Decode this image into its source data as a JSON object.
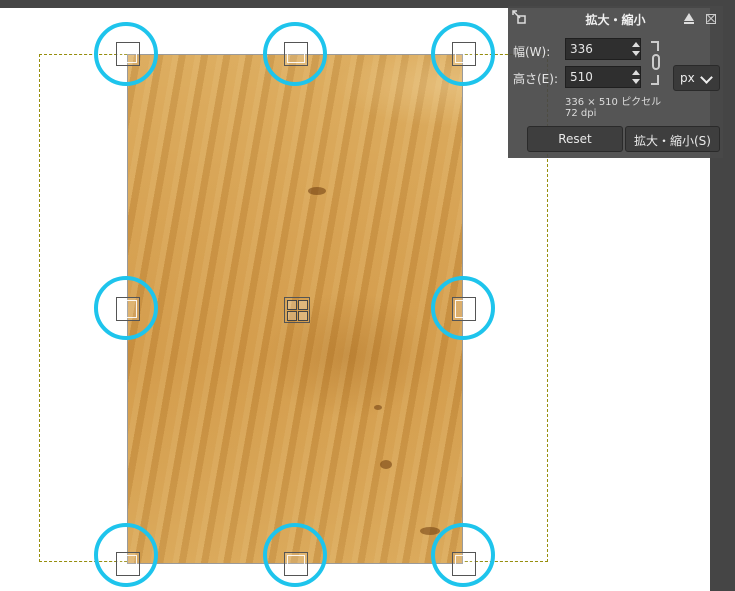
{
  "dialog": {
    "title": "拡大・縮小",
    "width_label": "幅(W):",
    "width_value": "336",
    "height_label": "高さ(E):",
    "height_value": "510",
    "unit": "px",
    "size_info": "336 × 510 ピクセル",
    "dpi_info": "72 dpi",
    "reset_label": "Reset",
    "scale_label": "拡大・縮小(S)"
  },
  "icons": {
    "tool": "scale-tool-icon",
    "raise": "raise-dialog-icon",
    "close": "close-icon",
    "chain": "chain-link-icon"
  },
  "colors": {
    "highlight_ring": "#1ec4ec",
    "dialog_bg": "#484848",
    "canvas_frame": "#454545"
  }
}
